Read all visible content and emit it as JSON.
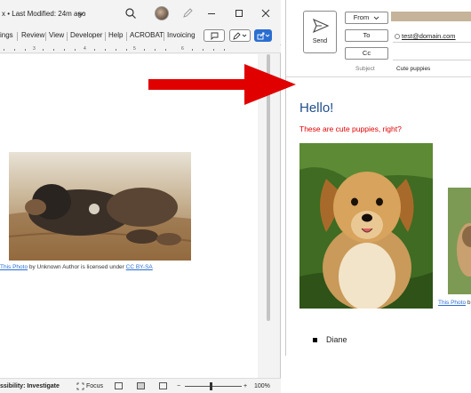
{
  "word": {
    "title": "x • Last Modified: 24m ago",
    "ribbon_tabs": [
      "ings",
      "Review",
      "View",
      "Developer",
      "Help",
      "ACROBAT",
      "Invoicing"
    ],
    "ruler_marks": [
      "3",
      "4",
      "5",
      "6"
    ],
    "image_caption": {
      "link_text": "This Photo",
      "middle_text": " by Unknown Author is licensed under ",
      "license_text": "CC BY-SA"
    },
    "status": {
      "accessibility": "ssibility: Investigate",
      "focus": "Focus",
      "zoom_minus": "−",
      "zoom_plus": "+",
      "zoom": "100%"
    }
  },
  "mail": {
    "send_label": "Send",
    "from_label": "From",
    "to_label": "To",
    "cc_label": "Cc",
    "to_value": "test@domain.com",
    "subject_label": "Subject",
    "subject_value": "Cute puppies",
    "greeting": "Hello!",
    "subline": "These are cute puppies, right?",
    "photo_caption_fragment": {
      "link_text": "This Photo",
      "tail": " b"
    },
    "bullet_item": "Diane",
    "colors": {
      "greeting": "#1f4e8c",
      "subline": "#e00000",
      "arrow": "#e00000",
      "accent": "#2b6ed1"
    }
  },
  "icons": [
    "search-icon",
    "avatar",
    "pen-icon",
    "minimize-icon",
    "maximize-icon",
    "close-icon",
    "comment-icon",
    "edit-icon",
    "share-icon",
    "send-icon",
    "arrow"
  ]
}
